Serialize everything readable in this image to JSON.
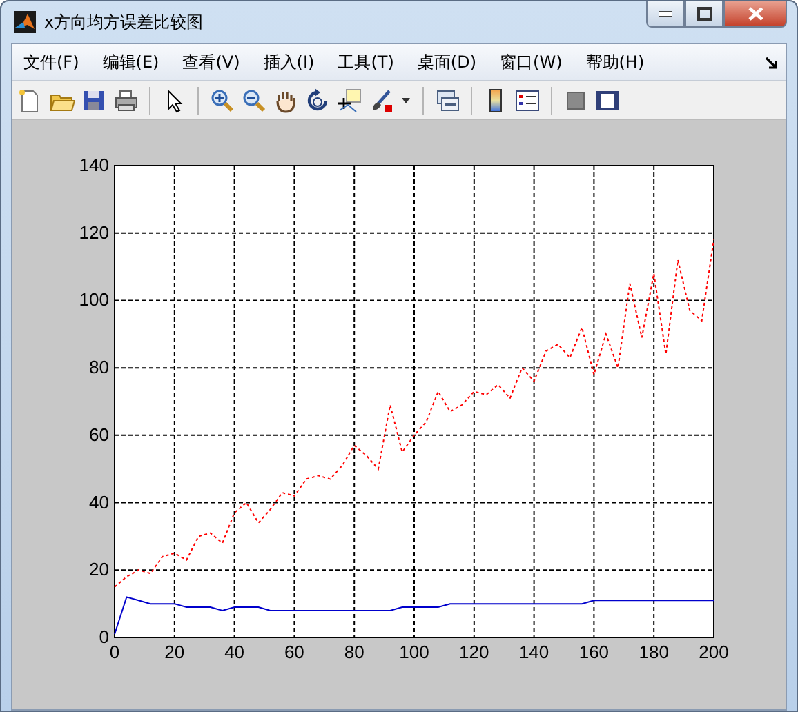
{
  "window": {
    "title": "x方向均方误差比较图"
  },
  "menu": [
    {
      "label": "文件(F)"
    },
    {
      "label": "编辑(E)"
    },
    {
      "label": "查看(V)"
    },
    {
      "label": "插入(I)"
    },
    {
      "label": "工具(T)"
    },
    {
      "label": "桌面(D)"
    },
    {
      "label": "窗口(W)"
    },
    {
      "label": "帮助(H)"
    }
  ],
  "figure": {
    "chart_data": {
      "type": "line",
      "x": [
        0,
        4,
        8,
        12,
        16,
        20,
        24,
        28,
        32,
        36,
        40,
        44,
        48,
        52,
        56,
        60,
        64,
        68,
        72,
        76,
        80,
        84,
        88,
        92,
        96,
        100,
        104,
        108,
        112,
        116,
        120,
        124,
        128,
        132,
        136,
        140,
        144,
        148,
        152,
        156,
        160,
        164,
        168,
        172,
        176,
        180,
        184,
        188,
        192,
        196,
        200
      ],
      "series": [
        {
          "color": "#ff0000",
          "line_style": "dotted",
          "values": [
            15,
            18,
            20,
            19,
            24,
            25,
            23,
            30,
            31,
            28,
            37,
            40,
            34,
            38,
            43,
            42,
            47,
            48,
            47,
            51,
            57,
            54,
            50,
            69,
            55,
            60,
            64,
            73,
            67,
            69,
            73,
            72,
            75,
            71,
            80,
            76,
            85,
            87,
            83,
            92,
            78,
            90,
            80,
            105,
            89,
            108,
            84,
            112,
            97,
            94,
            118
          ]
        },
        {
          "color": "#0000cc",
          "line_style": "solid",
          "values": [
            1,
            12,
            11,
            10,
            10,
            10,
            9,
            9,
            9,
            8,
            9,
            9,
            9,
            8,
            8,
            8,
            8,
            8,
            8,
            8,
            8,
            8,
            8,
            8,
            9,
            9,
            9,
            9,
            10,
            10,
            10,
            10,
            10,
            10,
            10,
            10,
            10,
            10,
            10,
            10,
            11,
            11,
            11,
            11,
            11,
            11,
            11,
            11,
            11,
            11,
            11
          ]
        }
      ],
      "grid": true,
      "xlim": [
        0,
        200
      ],
      "ylim": [
        0,
        140
      ],
      "xticks": [
        0,
        20,
        40,
        60,
        80,
        100,
        120,
        140,
        160,
        180,
        200
      ],
      "yticks": [
        0,
        20,
        40,
        60,
        80,
        100,
        120,
        140
      ]
    }
  }
}
